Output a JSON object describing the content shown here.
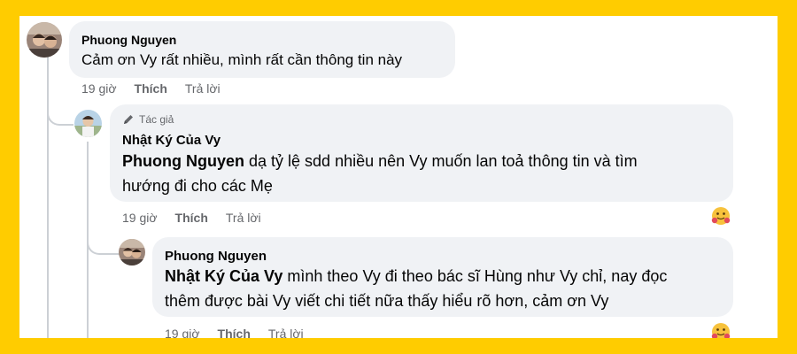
{
  "comments": [
    {
      "author": "Phuong Nguyen",
      "text": "Cảm ơn Vy rất nhiều, mình rất cần thông tin này",
      "time": "19 giờ",
      "like": "Thích",
      "reply": "Trả lời"
    },
    {
      "badge": "Tác giả",
      "author": "Nhật Ký Của Vy",
      "mention": "Phuong Nguyen",
      "text_line1": "dạ tỷ lệ sdd nhiều nên Vy muốn lan toả thông tin và tìm",
      "text_line2": "hướng đi cho các Mẹ",
      "time": "19 giờ",
      "like": "Thích",
      "reply": "Trả lời"
    },
    {
      "author": "Phuong Nguyen",
      "mention": "Nhật Ký Của Vy",
      "text_line1": "mình theo Vy đi theo bác sĩ Hùng như Vy chỉ, nay đọc",
      "text_line2": "thêm được bài Vy viết chi tiết nữa thấy hiểu rõ hơn, cảm ơn Vy",
      "time": "19 giờ",
      "like": "Thích",
      "reply": "Trả lời"
    }
  ],
  "icons": {
    "author_badge": "pencil-icon",
    "reaction": "hugging-face-icon"
  },
  "colors": {
    "frame": "#FFCC00",
    "bubble": "#f0f2f5",
    "meta_text": "#65676b",
    "thread_line": "#ccd0d5"
  }
}
